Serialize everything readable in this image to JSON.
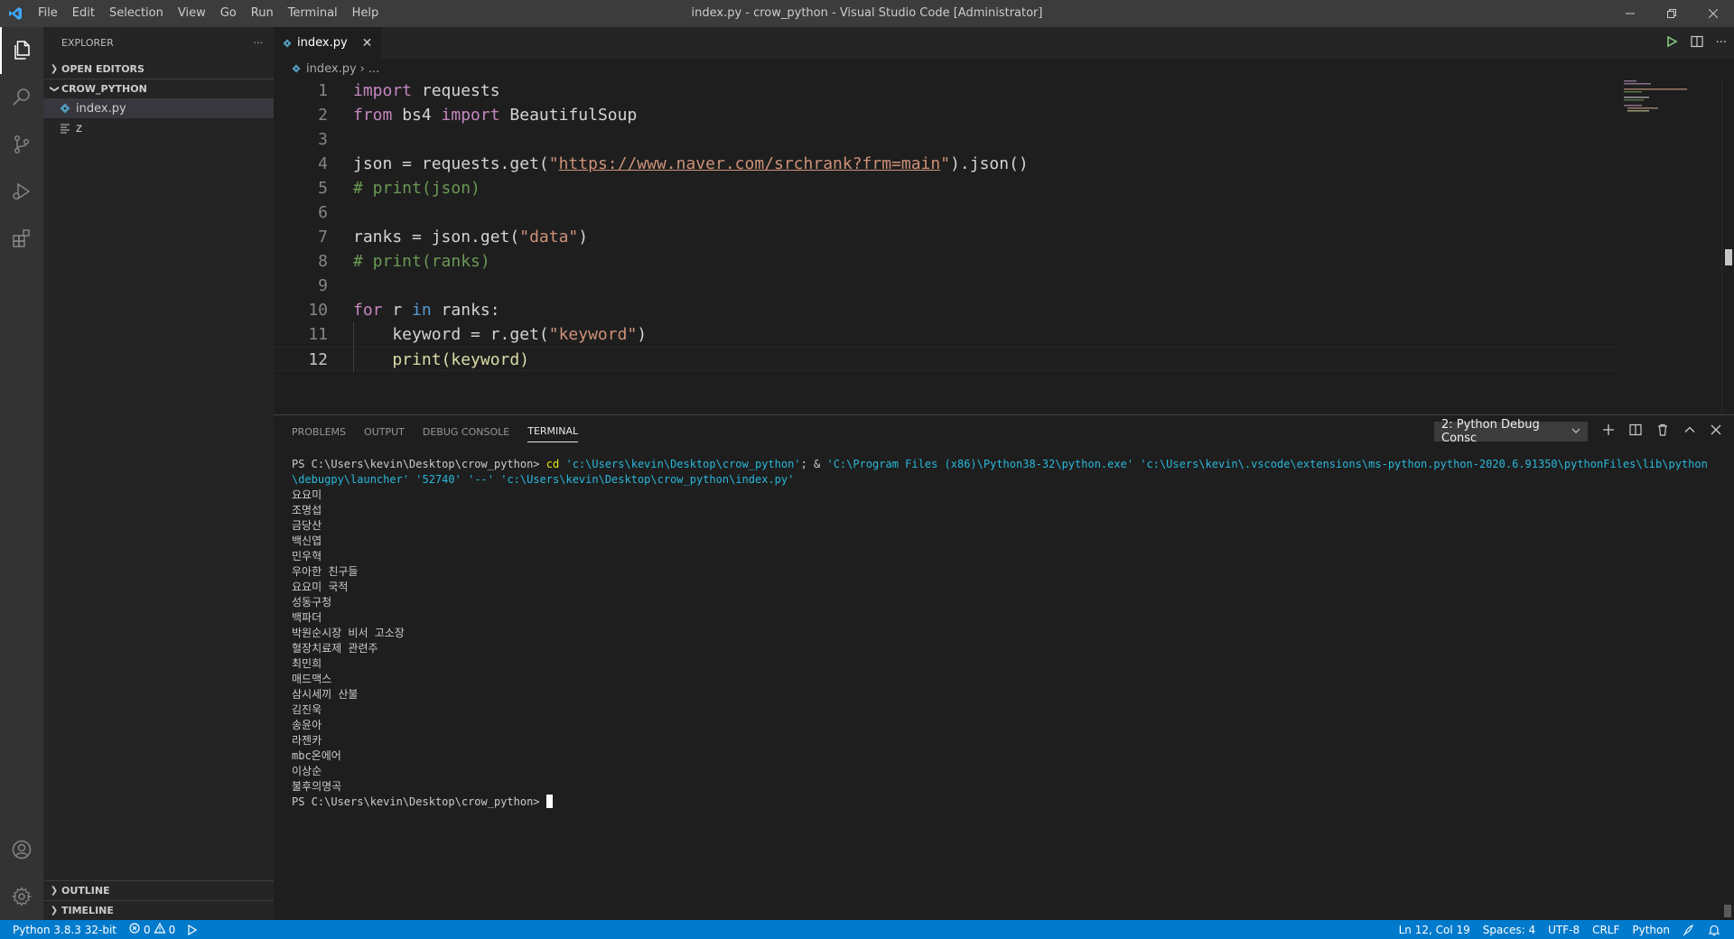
{
  "window": {
    "title": "index.py - crow_python - Visual Studio Code [Administrator]",
    "menu": [
      "File",
      "Edit",
      "Selection",
      "View",
      "Go",
      "Run",
      "Terminal",
      "Help"
    ]
  },
  "sidebar": {
    "header": "EXPLORER",
    "more": "···",
    "open_editors": "OPEN EDITORS",
    "folder": "CROW_PYTHON",
    "files": [
      "index.py",
      "z"
    ],
    "outline": "OUTLINE",
    "timeline": "TIMELINE"
  },
  "editor": {
    "tab_label": "index.py",
    "breadcrumb_file": "index.py",
    "breadcrumb_rest": "...",
    "lines": [
      {
        "num": "1"
      },
      {
        "num": "2"
      },
      {
        "num": "3"
      },
      {
        "num": "4"
      },
      {
        "num": "5"
      },
      {
        "num": "6"
      },
      {
        "num": "7"
      },
      {
        "num": "8"
      },
      {
        "num": "9"
      },
      {
        "num": "10"
      },
      {
        "num": "11"
      },
      {
        "num": "12"
      }
    ],
    "code": {
      "l1_kw": "import",
      "l1_rest": " requests",
      "l2_kw1": "from",
      "l2_mid": " bs4 ",
      "l2_kw2": "import",
      "l2_rest": " BeautifulSoup",
      "l4_a": "json = requests.get(",
      "l4_q1": "\"",
      "l4_url": "https://www.naver.com/srchrank?frm=main",
      "l4_q2": "\"",
      "l4_b": ").json()",
      "l5": "# print(json)",
      "l7_a": "ranks = json.get(",
      "l7_str": "\"data\"",
      "l7_b": ")",
      "l8": "# print(ranks)",
      "l10_kw1": "for",
      "l10_mid": " r ",
      "l10_kw2": "in",
      "l10_rest": " ranks:",
      "l11_a": "    keyword = r.get(",
      "l11_str": "\"keyword\"",
      "l11_b": ")",
      "l12": "    print(keyword)"
    }
  },
  "panel": {
    "tabs": [
      "PROBLEMS",
      "OUTPUT",
      "DEBUG CONSOLE",
      "TERMINAL"
    ],
    "active_tab": "TERMINAL",
    "terminal_select": "2: Python Debug Consc",
    "prompt": "PS C:\\Users\\kevin\\Desktop\\crow_python>",
    "cmd_cd": "cd",
    "cmd_path": "'c:\\Users\\kevin\\Desktop\\crow_python'",
    "cmd_sep": "; &",
    "cmd_python": "'C:\\Program Files (x86)\\Python38-32\\python.exe'",
    "cmd_launcher": "'c:\\Users\\kevin\\.vscode\\extensions\\ms-python.python-2020.6.91350\\pythonFiles\\lib\\python\\debugpy\\launcher'",
    "cmd_port": "'52740'",
    "cmd_dash": "'--'",
    "cmd_script": "'c:\\Users\\kevin\\Desktop\\crow_python\\index.py'",
    "output_lines": [
      "요요미",
      "조명섭",
      "금당산",
      "백신엽",
      "민우혁",
      "우아한 친구들",
      "요요미 국적",
      "성동구청",
      "백파더",
      "박원순시장 비서 고소장",
      "혈장치료제 관련주",
      "최민희",
      "매드맥스",
      "삼시세끼 산불",
      "김진욱",
      "송윤아",
      "라젠카",
      "mbc온에어",
      "이상순",
      "불후의명곡"
    ]
  },
  "statusbar": {
    "python": "Python 3.8.3 32-bit",
    "errors": "0",
    "warnings": "0",
    "position": "Ln 12, Col 19",
    "spaces": "Spaces: 4",
    "encoding": "UTF-8",
    "eol": "CRLF",
    "language": "Python"
  },
  "colors": {
    "statusbar": "#007acc",
    "activitybar": "#333333",
    "sidebar": "#252526",
    "editor": "#1e1e1e"
  }
}
